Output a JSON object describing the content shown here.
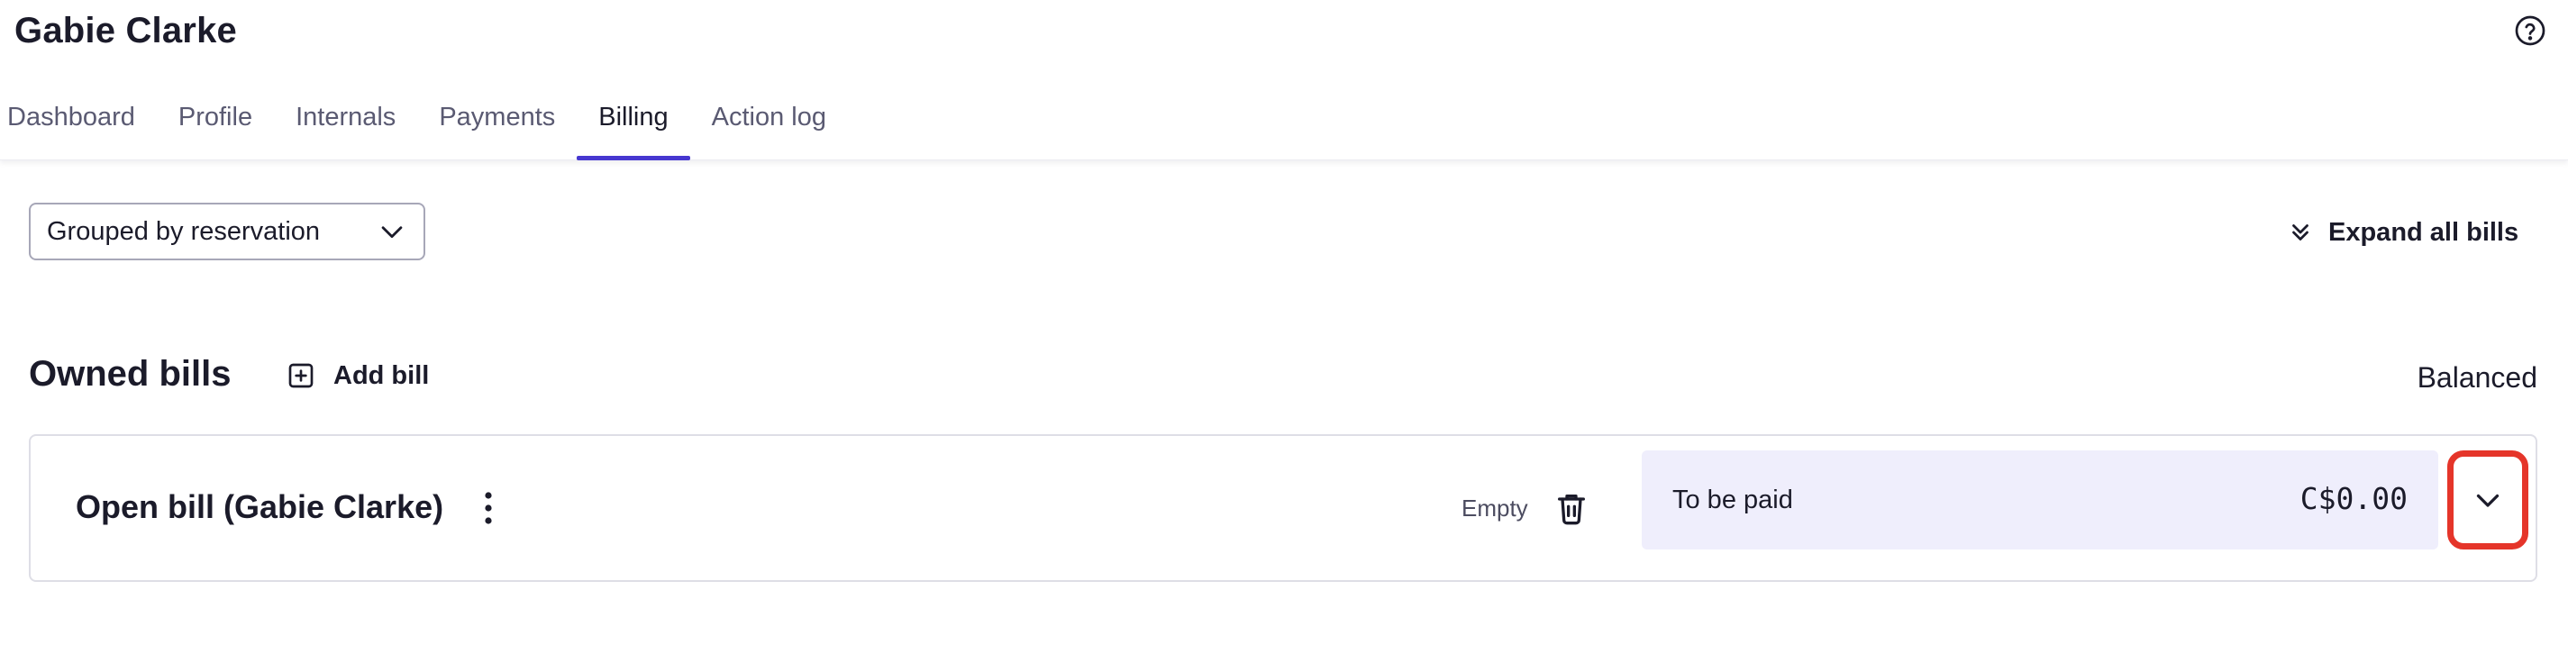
{
  "page": {
    "title": "Gabie Clarke"
  },
  "tabs": [
    {
      "label": "Dashboard",
      "active": false
    },
    {
      "label": "Profile",
      "active": false
    },
    {
      "label": "Internals",
      "active": false
    },
    {
      "label": "Payments",
      "active": false
    },
    {
      "label": "Billing",
      "active": true
    },
    {
      "label": "Action log",
      "active": false
    }
  ],
  "toolbar": {
    "grouping_selected": "Grouped by reservation",
    "expand_all_label": "Expand all bills"
  },
  "owned_bills": {
    "title": "Owned bills",
    "add_bill_label": "Add bill",
    "balance_status": "Balanced",
    "bills": [
      {
        "title": "Open bill (Gabie Clarke)",
        "status": "Empty",
        "amount_label": "To be paid",
        "amount_value": "C$0.00"
      }
    ]
  },
  "colors": {
    "accent": "#4637d0",
    "highlight": "#e5352a",
    "amount_background": "#efeefc"
  },
  "icons": [
    "help-icon",
    "chevron-down-icon",
    "double-chevron-down-icon",
    "plus-square-icon",
    "kebab-menu-icon",
    "trash-icon"
  ]
}
